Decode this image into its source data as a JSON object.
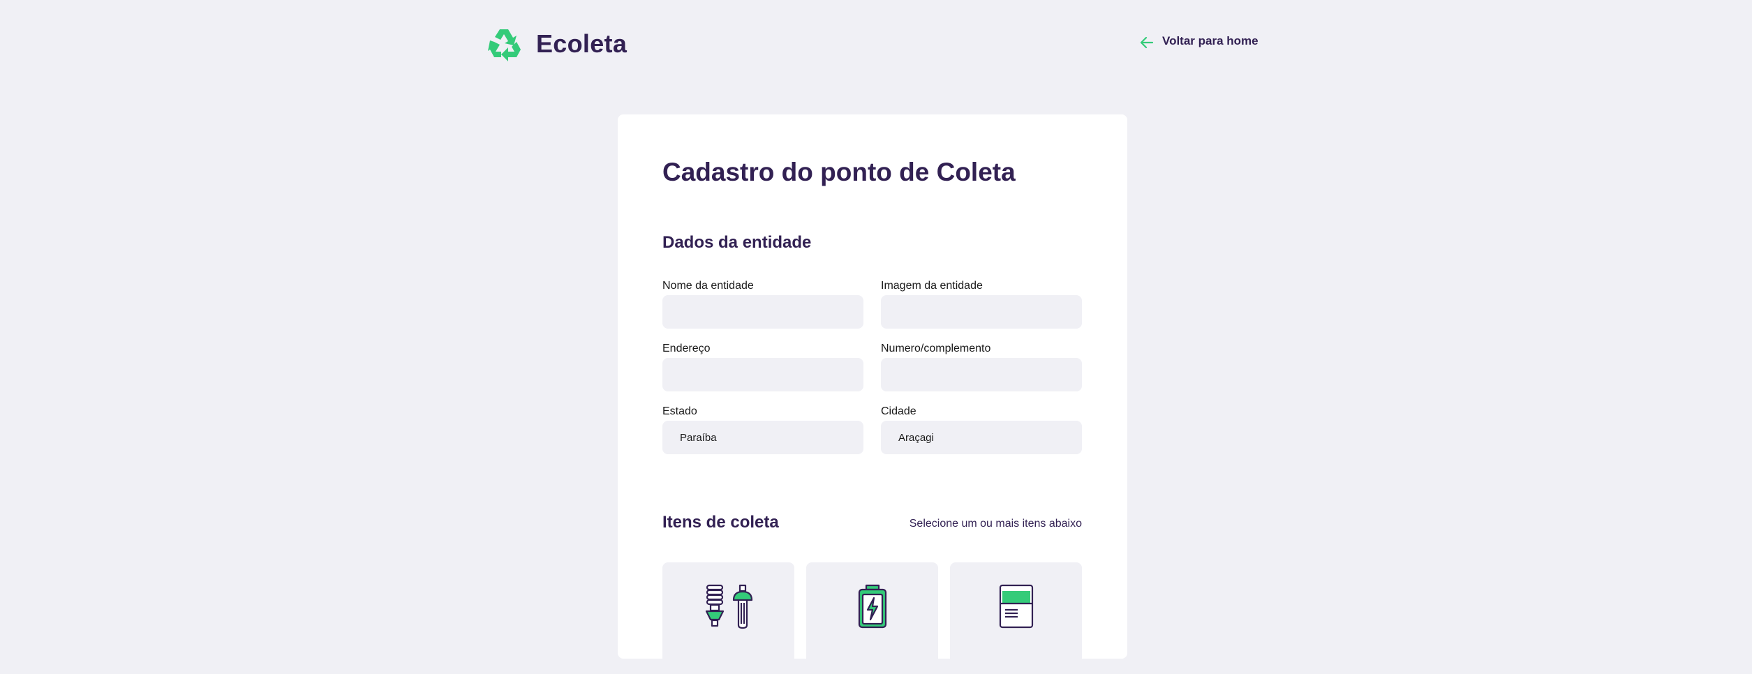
{
  "header": {
    "logo_text": "Ecoleta",
    "back_link_label": "Voltar para home"
  },
  "form": {
    "title": "Cadastro do ponto de Coleta",
    "entity_section_title": "Dados da entidade",
    "fields": {
      "entity_name": {
        "label": "Nome da entidade",
        "value": ""
      },
      "entity_image": {
        "label": "Imagem da entidade",
        "value": ""
      },
      "address": {
        "label": "Endereço",
        "value": ""
      },
      "number": {
        "label": "Numero/complemento",
        "value": ""
      },
      "state": {
        "label": "Estado",
        "value": "Paraíba"
      },
      "city": {
        "label": "Cidade",
        "value": "Araçagi"
      }
    },
    "items_section_title": "Itens de coleta",
    "items_hint": "Selecione um ou mais itens abaixo",
    "items": [
      {
        "icon": "lamps-icon"
      },
      {
        "icon": "battery-icon"
      },
      {
        "icon": "paper-icon"
      }
    ]
  },
  "colors": {
    "background": "#F0F0F5",
    "card": "#FFFFFF",
    "title": "#322153",
    "accent": "#34CB79"
  }
}
